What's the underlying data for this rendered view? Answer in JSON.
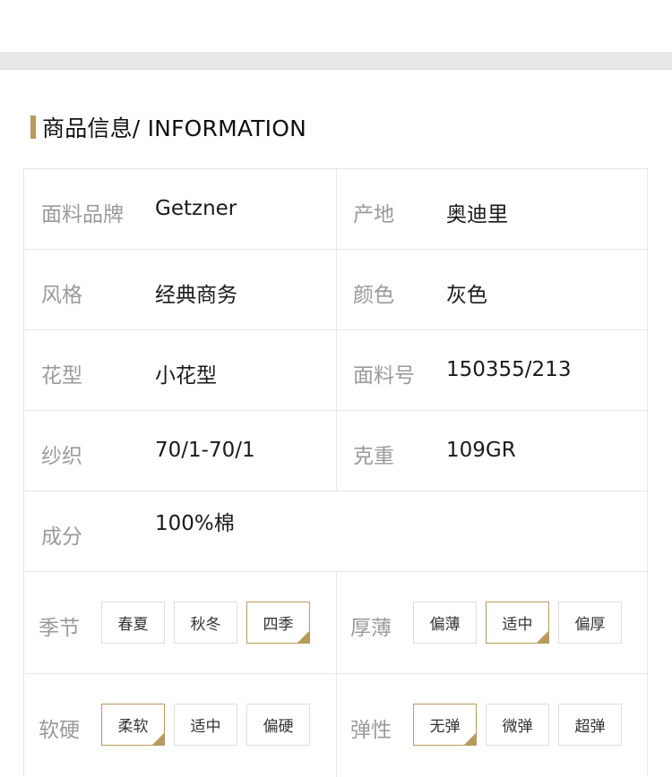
{
  "section": {
    "title": "商品信息/ INFORMATION",
    "accent": "#b89a5f"
  },
  "fabric_brand": {
    "label": "面料品牌",
    "value": "Getzner"
  },
  "origin": {
    "label": "产地",
    "value": "奥迪里"
  },
  "style": {
    "label": "风格",
    "value": "经典商务"
  },
  "color": {
    "label": "颜色",
    "value": "灰色"
  },
  "pattern": {
    "label": "花型",
    "value": "小花型"
  },
  "fabric_no": {
    "label": "面料号",
    "value": "150355/213"
  },
  "yarn": {
    "label": "纱织",
    "value": "70/1-70/1"
  },
  "weight": {
    "label": "克重",
    "value": "109GR"
  },
  "composition": {
    "label": "成分",
    "value": "100%棉"
  },
  "season": {
    "label": "季节",
    "options": [
      "春夏",
      "秋冬",
      "四季"
    ],
    "selected": "四季"
  },
  "thickness": {
    "label": "厚薄",
    "options": [
      "偏薄",
      "适中",
      "偏厚"
    ],
    "selected": "适中"
  },
  "softness": {
    "label": "软硬",
    "options": [
      "柔软",
      "适中",
      "偏硬"
    ],
    "selected": "柔软"
  },
  "elasticity": {
    "label": "弹性",
    "options": [
      "无弹",
      "微弹",
      "超弹"
    ],
    "selected": "无弹"
  }
}
